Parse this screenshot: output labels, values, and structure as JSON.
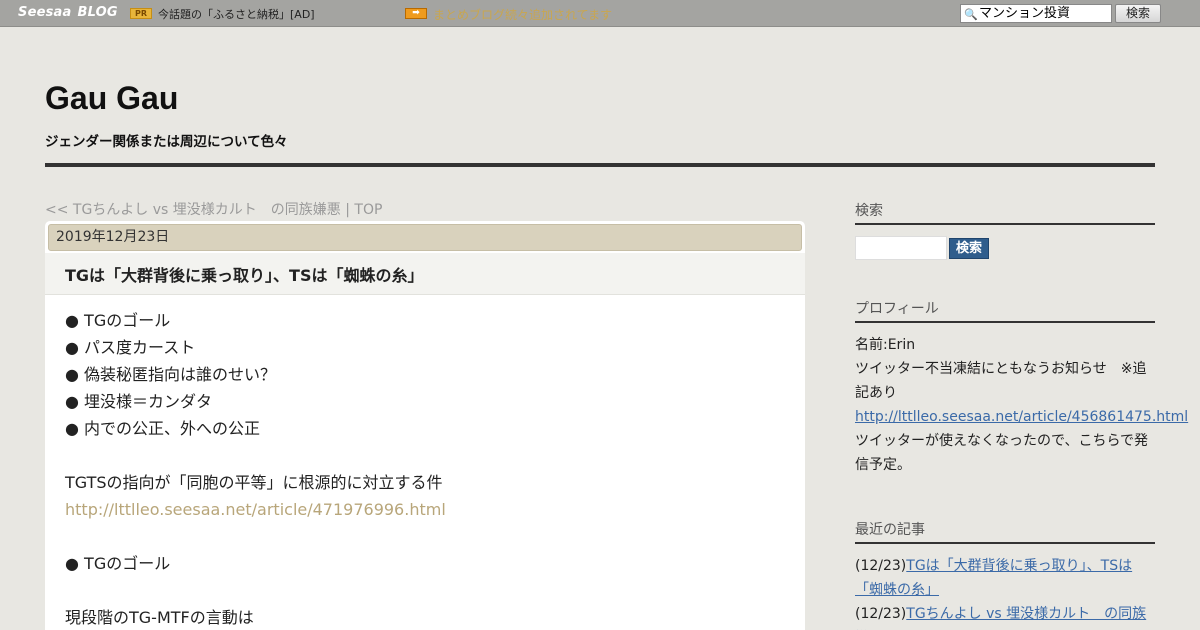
{
  "topbar": {
    "logo_main": "Seesaa",
    "logo_blog": "BLOG",
    "pr_badge": "PR",
    "pr_text": "今話題の「ふるさと納税」[AD]",
    "arrow_badge": "➡",
    "notice": "まとめブログ続々追加されてます",
    "search_value": "マンション投資",
    "search_button": "検索"
  },
  "header": {
    "title": "Gau Gau",
    "description": "ジェンダー関係または周辺について色々"
  },
  "nav": {
    "prev": "<< TGちんよし vs 埋没様カルト　の同族嫌悪",
    "separator": " | ",
    "top": "TOP"
  },
  "post": {
    "date": "2019年12月23日",
    "title": "TGは「大群背後に乗っ取り」、TSは「蜘蛛の糸」",
    "lines": [
      "● TGのゴール",
      "● パス度カースト",
      "● 偽装秘匿指向は誰のせい？",
      "● 埋没様＝カンダタ",
      "● 内での公正、外への公正",
      "",
      "TGTSの指向が「同胞の平等」に根源的に対立する件",
      "http://lttlleo.seesaa.net/article/471976996.html",
      "",
      "● TGのゴール",
      "",
      "現段階のTG-MTFの言動は"
    ]
  },
  "sidebar": {
    "search": {
      "heading": "検索",
      "button": "検索"
    },
    "profile": {
      "heading": "プロフィール",
      "name": "名前:Erin",
      "notice": "ツイッター不当凍結にともなうお知らせ　※追記あり",
      "link": "http://lttlleo.seesaa.net/article/456861475.html",
      "text": "ツイッターが使えなくなったので、こちらで発信予定。"
    },
    "recent": {
      "heading": "最近の記事",
      "items": [
        {
          "date": "(12/23)",
          "title": "TGは「大群背後に乗っ取り」、TSは「蜘蛛の糸」"
        },
        {
          "date": "(12/23)",
          "title": "TGちんよし vs 埋没様カルト　の同族嫌悪"
        }
      ]
    }
  },
  "colors": {
    "background": "#e8e7e2",
    "topbar": "#a4a4a1",
    "date_bar": "#d9d2bd",
    "link_muted": "#b8a67a",
    "link_blue": "#3b6aa8",
    "search_button": "#2f5d8c"
  }
}
